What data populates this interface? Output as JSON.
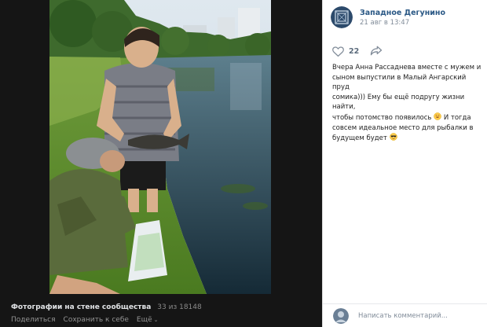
{
  "viewer": {
    "album_title": "Фотографии на стене сообщества",
    "counter": "33 из 18148",
    "actions": {
      "share": "Поделиться",
      "save": "Сохранить к себе",
      "more": "Ещё"
    }
  },
  "post": {
    "group_name": "Западное Дегунино",
    "date": "21 авг в 13:47",
    "likes": "22",
    "text_lines": [
      "Вчера Анна Рассаднева вместе с мужем и",
      "сыном выпустили в Малый Ангарский пруд",
      "сомика))) Ему бы ещё подругу жизни найти,",
      "чтобы потомство появилось",
      " И тогда",
      "совсем идеальное место для рыбалки в",
      "будущем будет"
    ]
  },
  "comment": {
    "placeholder": "Написать комментарий..."
  },
  "icons": {
    "like": "heart-icon",
    "share": "share-arrow-icon",
    "more": "chevron-down-icon"
  },
  "colors": {
    "link": "#2a5885",
    "meta": "#818c99",
    "viewer_bg": "#151515"
  }
}
